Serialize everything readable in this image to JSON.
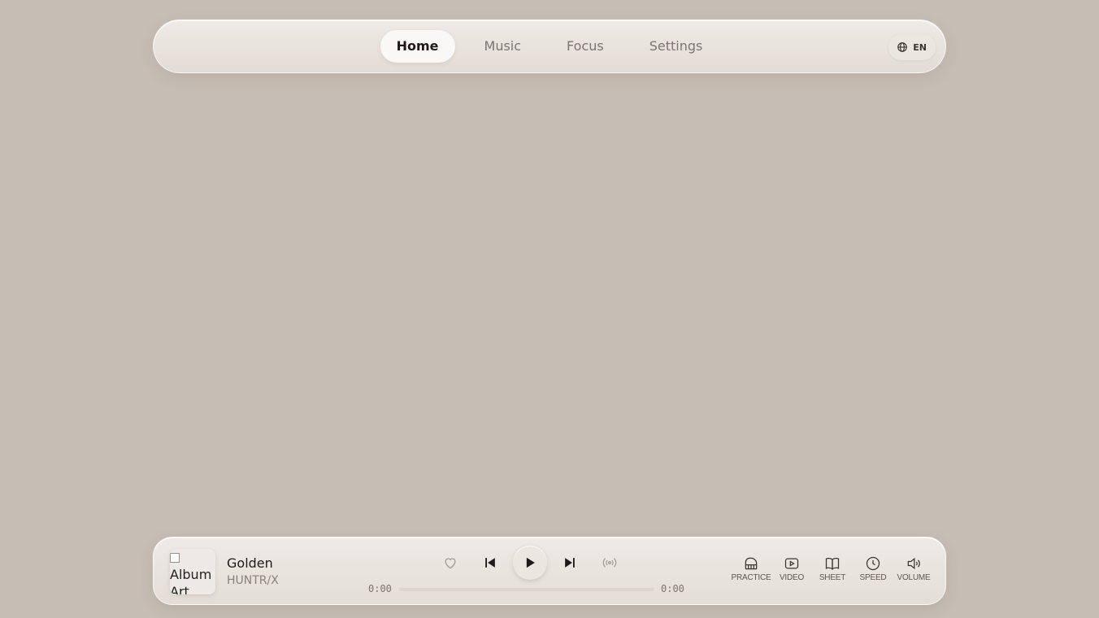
{
  "nav": {
    "tabs": [
      {
        "label": "Home",
        "active": true
      },
      {
        "label": "Music",
        "active": false
      },
      {
        "label": "Focus",
        "active": false
      },
      {
        "label": "Settings",
        "active": false
      }
    ],
    "language": "EN"
  },
  "player": {
    "album_alt": "Album Art",
    "title": "Golden",
    "artist": "HUNTR/X",
    "current_time": "0:00",
    "duration": "0:00",
    "progress": 0,
    "tools": [
      {
        "label": "PRACTICE",
        "icon": "piano-icon"
      },
      {
        "label": "VIDEO",
        "icon": "video-icon"
      },
      {
        "label": "SHEET",
        "icon": "book-icon"
      },
      {
        "label": "SPEED",
        "icon": "clock-icon"
      },
      {
        "label": "VOLUME",
        "icon": "volume-icon"
      }
    ]
  },
  "colors": {
    "background": "#c6bdb4",
    "panel": "#efeae6",
    "text_primary": "#1f1a17",
    "text_muted": "#7d746e"
  }
}
